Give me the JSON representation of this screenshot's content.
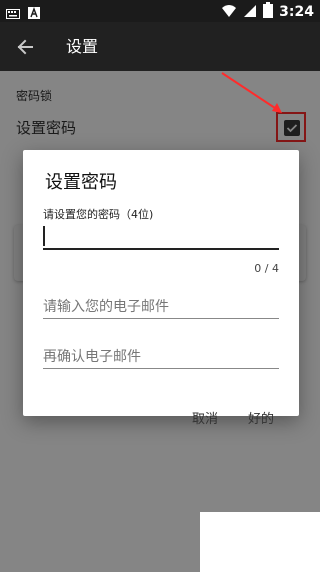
{
  "status_bar": {
    "time": "3:24",
    "icons": [
      "keyboard-icon",
      "a-icon",
      "wifi-icon",
      "signal-icon",
      "battery-icon"
    ]
  },
  "app_bar": {
    "title": "设置",
    "back_icon": "arrow-left-icon"
  },
  "content": {
    "section_header": "密码锁",
    "preference_title": "设置密码",
    "checkbox_checked": true
  },
  "dialog": {
    "title": "设置密码",
    "password_label": "请设置您的密码（4位)",
    "password_value": "",
    "counter": "0 / 4",
    "email_placeholder": "请输入您的电子邮件",
    "confirm_email_placeholder": "再确认电子邮件",
    "cancel_label": "取消",
    "ok_label": "好的"
  },
  "colors": {
    "app_bar": "#212121",
    "status_bar": "#1b1b1b",
    "highlight": "#ff2b2b",
    "scrim": "rgba(0,0,0,0.48)"
  }
}
